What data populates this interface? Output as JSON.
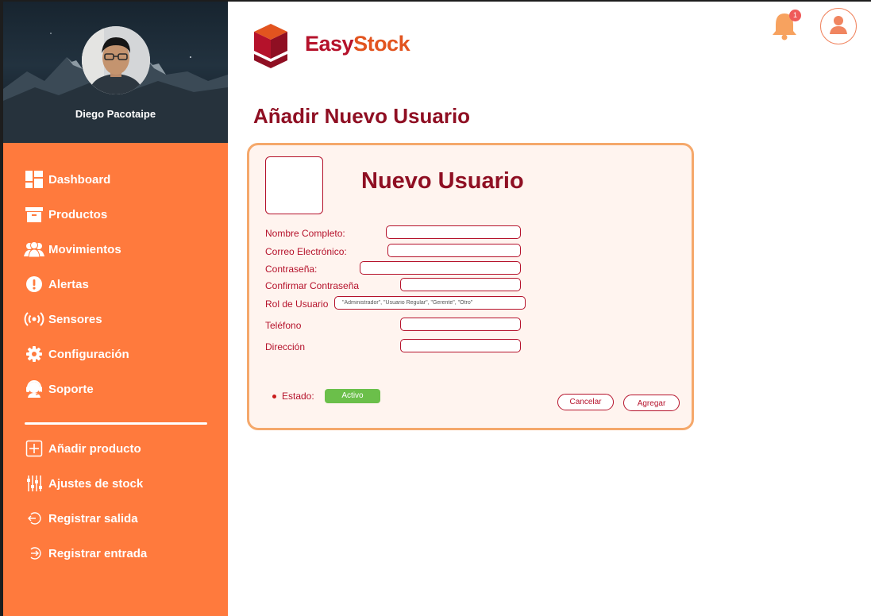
{
  "user": {
    "name": "Diego Pacotaipe"
  },
  "sidebar": {
    "main_items": [
      {
        "label": "Dashboard",
        "icon": "dashboard-icon"
      },
      {
        "label": "Productos",
        "icon": "archive-box-icon"
      },
      {
        "label": "Movimientos",
        "icon": "users-icon"
      },
      {
        "label": "Alertas",
        "icon": "alert-icon"
      },
      {
        "label": "Sensores",
        "icon": "broadcast-icon"
      },
      {
        "label": "Configuración",
        "icon": "gear-icon"
      },
      {
        "label": "Soporte",
        "icon": "headset-icon"
      }
    ],
    "action_items": [
      {
        "label": "Añadir producto",
        "icon": "plus-box-icon"
      },
      {
        "label": "Ajustes de stock",
        "icon": "sliders-icon"
      },
      {
        "label": "Registrar salida",
        "icon": "exit-icon"
      },
      {
        "label": "Registrar entrada",
        "icon": "enter-icon"
      }
    ]
  },
  "header": {
    "logo_part1": "Easy",
    "logo_part2": "Stock",
    "notification_count": "1"
  },
  "page": {
    "title": "Añadir Nuevo Usuario"
  },
  "form": {
    "title": "Nuevo Usuario",
    "fields": [
      {
        "label": "Nombre Completo:",
        "value": "",
        "placeholder": ""
      },
      {
        "label": "Correo Electrónico:",
        "value": "",
        "placeholder": ""
      },
      {
        "label": "Contraseña:",
        "value": "",
        "placeholder": ""
      },
      {
        "label": "Confirmar Contraseña",
        "value": "",
        "placeholder": ""
      },
      {
        "label": "Rol de Usuario",
        "value": "",
        "placeholder": "\"Administrador\", \"Usuario Regular\", \"Gerente\", \"Otro\""
      },
      {
        "label": "Teléfono",
        "value": "",
        "placeholder": ""
      },
      {
        "label": "Dirección",
        "value": "",
        "placeholder": ""
      }
    ],
    "estado_label": "Estado:",
    "estado_value": "Activo",
    "cancel_label": "Cancelar",
    "submit_label": "Agregar"
  },
  "colors": {
    "sidebar_bg": "#ff7a3d",
    "brand_dark_red": "#8f0f23",
    "brand_red": "#b5122b",
    "card_border": "#f5a86b",
    "status_active": "#6bbf4a",
    "badge": "#ef5a5a"
  }
}
